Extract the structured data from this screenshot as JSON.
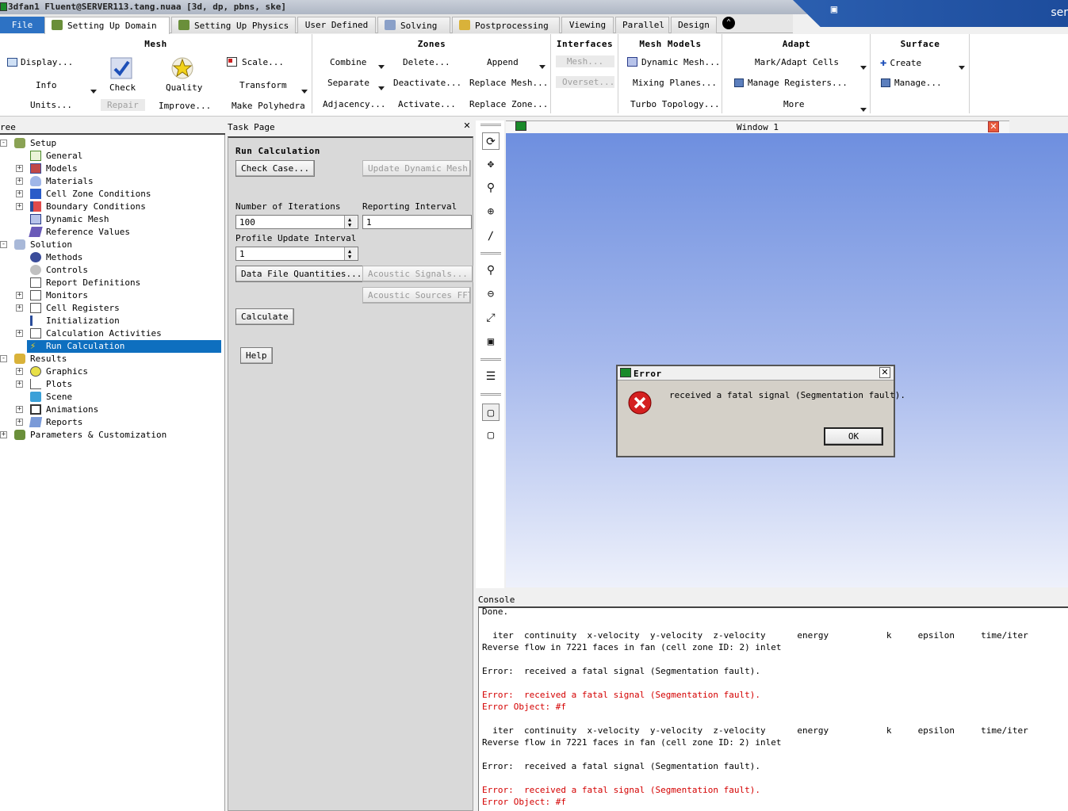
{
  "window": {
    "title": "3dfan1 Fluent@SERVER113.tang.nuaa  [3d, dp, pbns, ske]",
    "corner_text": "ser"
  },
  "tabs": [
    {
      "label": "File"
    },
    {
      "label": "Setting Up Domain"
    },
    {
      "label": "Setting Up Physics"
    },
    {
      "label": "User Defined"
    },
    {
      "label": "Solving"
    },
    {
      "label": "Postprocessing"
    },
    {
      "label": "Viewing"
    },
    {
      "label": "Parallel"
    },
    {
      "label": "Design"
    }
  ],
  "ribbon": {
    "mesh": {
      "title": "Mesh",
      "display": "Display...",
      "info": "Info",
      "units": "Units...",
      "check": "Check",
      "repair": "Repair",
      "quality": "Quality",
      "improve": "Improve...",
      "scale": "Scale...",
      "transform": "Transform",
      "make_polyhedra": "Make Polyhedra"
    },
    "zones": {
      "title": "Zones",
      "combine": "Combine",
      "separate": "Separate",
      "adjacency": "Adjacency...",
      "delete": "Delete...",
      "deactivate": "Deactivate...",
      "activate": "Activate...",
      "append": "Append",
      "replace_mesh": "Replace Mesh...",
      "replace_zone": "Replace Zone..."
    },
    "interfaces": {
      "title": "Interfaces",
      "mesh": "Mesh...",
      "overset": "Overset..."
    },
    "mesh_models": {
      "title": "Mesh Models",
      "dynamic_mesh": "Dynamic Mesh...",
      "mixing_planes": "Mixing Planes...",
      "turbo_topology": "Turbo Topology..."
    },
    "adapt": {
      "title": "Adapt",
      "mark_adapt": "Mark/Adapt Cells",
      "manage_registers": "Manage Registers...",
      "more": "More"
    },
    "surface": {
      "title": "Surface",
      "create": "Create",
      "manage": "Manage..."
    }
  },
  "tree": {
    "header": "ree",
    "items": [
      {
        "label": "Setup"
      },
      {
        "label": "General"
      },
      {
        "label": "Models"
      },
      {
        "label": "Materials"
      },
      {
        "label": "Cell Zone Conditions"
      },
      {
        "label": "Boundary Conditions"
      },
      {
        "label": "Dynamic Mesh"
      },
      {
        "label": "Reference Values"
      },
      {
        "label": "Solution"
      },
      {
        "label": "Methods"
      },
      {
        "label": "Controls"
      },
      {
        "label": "Report Definitions"
      },
      {
        "label": "Monitors"
      },
      {
        "label": "Cell Registers"
      },
      {
        "label": "Initialization"
      },
      {
        "label": "Calculation Activities"
      },
      {
        "label": "Run Calculation"
      },
      {
        "label": "Results"
      },
      {
        "label": "Graphics"
      },
      {
        "label": "Plots"
      },
      {
        "label": "Scene"
      },
      {
        "label": "Animations"
      },
      {
        "label": "Reports"
      },
      {
        "label": "Parameters & Customization"
      }
    ]
  },
  "task": {
    "header": "Task Page",
    "title": "Run Calculation",
    "check_case": "Check Case...",
    "update_dynamic_mesh": "Update Dynamic Mesh...",
    "num_iterations_label": "Number of Iterations",
    "num_iterations_value": "100",
    "reporting_interval_label": "Reporting Interval",
    "reporting_interval_value": "1",
    "profile_update_label": "Profile Update Interval",
    "profile_update_value": "1",
    "data_file_quantities": "Data File Quantities...",
    "acoustic_signals": "Acoustic Signals...",
    "acoustic_sources_fft": "Acoustic Sources FFT...",
    "calculate": "Calculate",
    "help": "Help"
  },
  "graphics_window": {
    "title": "Window 1"
  },
  "dialog": {
    "title": "Error",
    "message": "received a fatal signal (Segmentation fault).",
    "ok": "OK"
  },
  "console": {
    "header": "Console",
    "lines": [
      {
        "text": "Done.",
        "color": "normal"
      },
      {
        "text": "",
        "color": "normal"
      },
      {
        "text": "  iter  continuity  x-velocity  y-velocity  z-velocity      energy           k     epsilon     time/iter",
        "color": "normal"
      },
      {
        "text": "Reverse flow in 7221 faces in fan (cell zone ID: 2) inlet",
        "color": "normal"
      },
      {
        "text": "",
        "color": "normal"
      },
      {
        "text": "Error:  received a fatal signal (Segmentation fault).",
        "color": "normal"
      },
      {
        "text": "",
        "color": "normal"
      },
      {
        "text": "Error:  received a fatal signal (Segmentation fault).",
        "color": "red"
      },
      {
        "text": "Error Object: #f",
        "color": "red"
      },
      {
        "text": "",
        "color": "normal"
      },
      {
        "text": "  iter  continuity  x-velocity  y-velocity  z-velocity      energy           k     epsilon     time/iter",
        "color": "normal"
      },
      {
        "text": "Reverse flow in 7221 faces in fan (cell zone ID: 2) inlet",
        "color": "normal"
      },
      {
        "text": "",
        "color": "normal"
      },
      {
        "text": "Error:  received a fatal signal (Segmentation fault).",
        "color": "normal"
      },
      {
        "text": "",
        "color": "normal"
      },
      {
        "text": "Error:  received a fatal signal (Segmentation fault).",
        "color": "red"
      },
      {
        "text": "Error Object: #f",
        "color": "red"
      }
    ]
  },
  "colors": {
    "selection": "#0e6fbf",
    "error_text": "#d40000",
    "file_tab": "#2d72c4"
  }
}
